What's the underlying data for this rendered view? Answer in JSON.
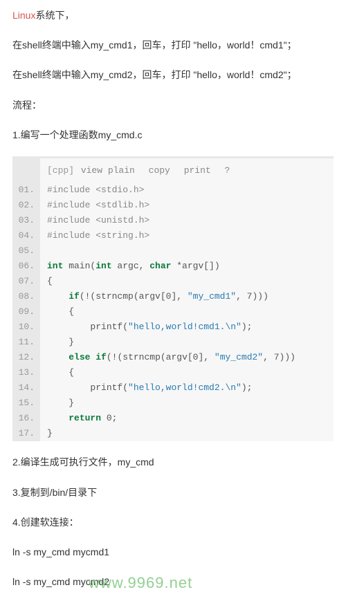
{
  "intro": {
    "linux_prefix": "Linux",
    "linux_suffix": "系统下，",
    "line2": "在shell终端中输入my_cmd1，回车，打印 \"hello，world！cmd1\"；",
    "line3": "在shell终端中输入my_cmd2，回车，打印 \"hello，world！cmd2\"；",
    "flow_label": "流程：",
    "step1": "1.编写一个处理函数my_cmd.c"
  },
  "toolbar": {
    "lang": "[cpp]",
    "view": "view plain",
    "copy": "copy",
    "print": "print",
    "help": "?"
  },
  "code": {
    "lines": [
      {
        "n": "01.",
        "segs": [
          {
            "t": "#include <stdio.h>",
            "c": "pp"
          }
        ]
      },
      {
        "n": "02.",
        "segs": [
          {
            "t": "#include <stdlib.h>",
            "c": "pp"
          }
        ]
      },
      {
        "n": "03.",
        "segs": [
          {
            "t": "#include <unistd.h>",
            "c": "pp"
          }
        ]
      },
      {
        "n": "04.",
        "segs": [
          {
            "t": "#include <string.h>",
            "c": "pp"
          }
        ]
      },
      {
        "n": "05.",
        "segs": [
          {
            "t": "",
            "c": ""
          }
        ]
      },
      {
        "n": "06.",
        "segs": [
          {
            "t": "int",
            "c": "kw"
          },
          {
            "t": " main(",
            "c": ""
          },
          {
            "t": "int",
            "c": "kw"
          },
          {
            "t": " argc, ",
            "c": ""
          },
          {
            "t": "char",
            "c": "kw"
          },
          {
            "t": " *argv[])",
            "c": ""
          }
        ]
      },
      {
        "n": "07.",
        "segs": [
          {
            "t": "{",
            "c": ""
          }
        ]
      },
      {
        "n": "08.",
        "segs": [
          {
            "t": "    ",
            "c": ""
          },
          {
            "t": "if",
            "c": "kw"
          },
          {
            "t": "(!(strncmp(argv[0], ",
            "c": ""
          },
          {
            "t": "\"my_cmd1\"",
            "c": "str"
          },
          {
            "t": ", 7)))",
            "c": ""
          }
        ]
      },
      {
        "n": "09.",
        "segs": [
          {
            "t": "    {",
            "c": ""
          }
        ]
      },
      {
        "n": "10.",
        "segs": [
          {
            "t": "        printf(",
            "c": ""
          },
          {
            "t": "\"hello,world!cmd1.\\n\"",
            "c": "str"
          },
          {
            "t": ");",
            "c": ""
          }
        ]
      },
      {
        "n": "11.",
        "segs": [
          {
            "t": "    }",
            "c": ""
          }
        ]
      },
      {
        "n": "12.",
        "segs": [
          {
            "t": "    ",
            "c": ""
          },
          {
            "t": "else",
            "c": "kw"
          },
          {
            "t": " ",
            "c": ""
          },
          {
            "t": "if",
            "c": "kw"
          },
          {
            "t": "(!(strncmp(argv[0], ",
            "c": ""
          },
          {
            "t": "\"my_cmd2\"",
            "c": "str"
          },
          {
            "t": ", 7)))",
            "c": ""
          }
        ]
      },
      {
        "n": "13.",
        "segs": [
          {
            "t": "    {",
            "c": ""
          }
        ]
      },
      {
        "n": "14.",
        "segs": [
          {
            "t": "        printf(",
            "c": ""
          },
          {
            "t": "\"hello,world!cmd2.\\n\"",
            "c": "str"
          },
          {
            "t": ");",
            "c": ""
          }
        ]
      },
      {
        "n": "15.",
        "segs": [
          {
            "t": "    }",
            "c": ""
          }
        ]
      },
      {
        "n": "16.",
        "segs": [
          {
            "t": "    ",
            "c": ""
          },
          {
            "t": "return",
            "c": "kw"
          },
          {
            "t": " 0;",
            "c": ""
          }
        ]
      },
      {
        "n": "17.",
        "segs": [
          {
            "t": "}",
            "c": ""
          }
        ]
      }
    ]
  },
  "steps": {
    "s2": "2.编译生成可执行文件，my_cmd",
    "s3": "3.复制到/bin/目录下",
    "s4": "4.创建软连接：",
    "ln1": "ln -s my_cmd mycmd1",
    "ln2": "ln -s my_cmd mycmd2"
  },
  "watermark": "www.9969.net"
}
